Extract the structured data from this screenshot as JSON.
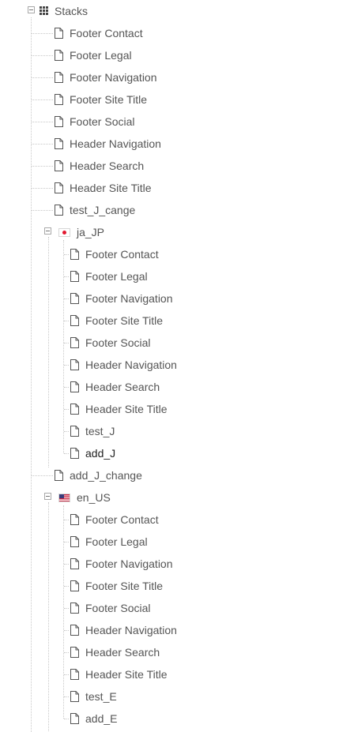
{
  "root": {
    "label": "Stacks",
    "icon": "grid-icon",
    "items": [
      "Footer Contact",
      "Footer Legal",
      "Footer Navigation",
      "Footer Site Title",
      "Footer Social",
      "Header Navigation",
      "Header Search",
      "Header Site Title",
      "test_J_cange"
    ]
  },
  "ja_JP": {
    "label": "ja_JP",
    "icon": "japan-flag-icon",
    "items": [
      "Footer Contact",
      "Footer Legal",
      "Footer Navigation",
      "Footer Site Title",
      "Footer Social",
      "Header Navigation",
      "Header Search",
      "Header Site Title",
      "test_J",
      "add_J"
    ]
  },
  "after_ja": {
    "items": [
      "add_J_change"
    ]
  },
  "en_US": {
    "label": "en_US",
    "icon": "us-flag-icon",
    "items": [
      "Footer Contact",
      "Footer Legal",
      "Footer Navigation",
      "Footer Site Title",
      "Footer Social",
      "Header Navigation",
      "Header Search",
      "Header Site Title",
      "test_E",
      "add_E"
    ]
  },
  "colors": {
    "text": "#555555",
    "active_text": "#222222",
    "tree_line": "#c8c8c8"
  }
}
